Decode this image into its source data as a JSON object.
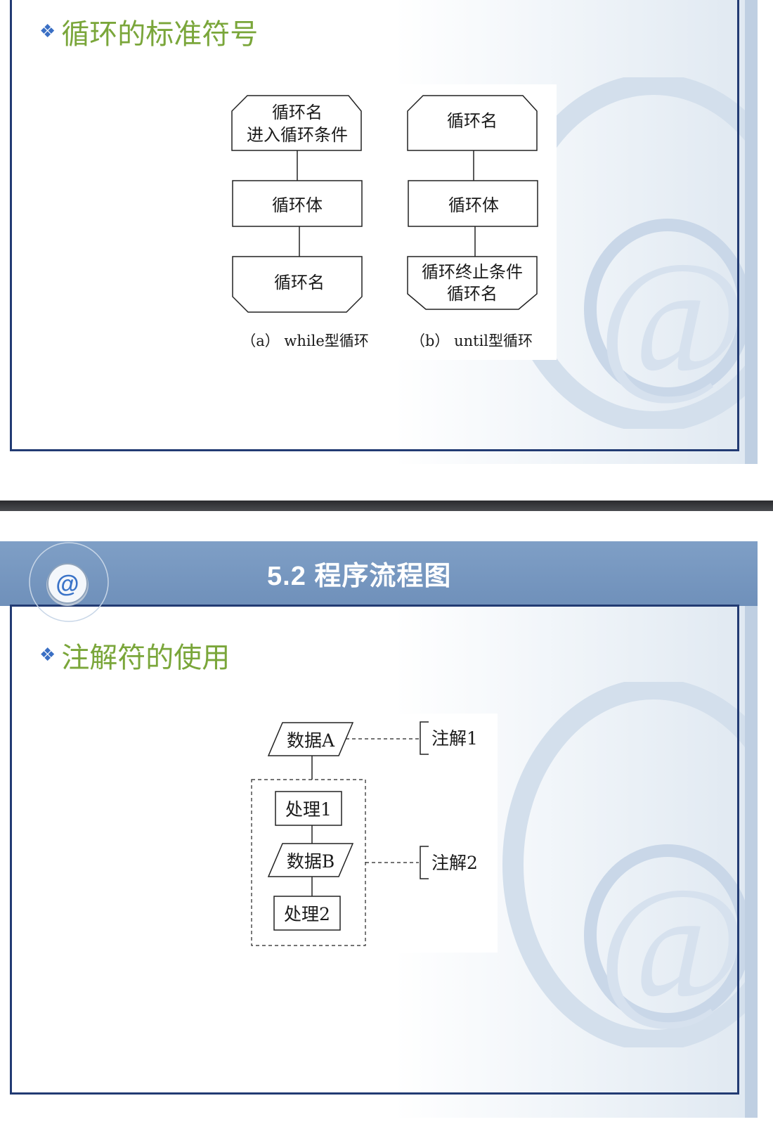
{
  "slide1": {
    "bullet_title": "循环的标准符号",
    "diagram_a": {
      "top_line1": "循环名",
      "top_line2": "进入循环条件",
      "body": "循环体",
      "bottom": "循环名",
      "caption": "（a） while型循环"
    },
    "diagram_b": {
      "top": "循环名",
      "body": "循环体",
      "bottom_line1": "循环终止条件",
      "bottom_line2": "循环名",
      "caption": "（b） until型循环"
    }
  },
  "slide2": {
    "header_title": "5.2  程序流程图",
    "bullet_title": "注解符的使用",
    "flow": {
      "data_a": "数据A",
      "process1": "处理1",
      "data_b": "数据B",
      "process2": "处理2",
      "note1": "注解1",
      "note2": "注解2"
    }
  },
  "colors": {
    "frame": "#223b73",
    "bullet_text": "#7aa63a",
    "bullet_diamond": "#3a6fc4",
    "header_band": "#7f9fc6"
  },
  "icons": {
    "bullet": "diamond-bullet-icon",
    "badge": "at-sign-icon",
    "watermark": "at-sign-watermark"
  }
}
